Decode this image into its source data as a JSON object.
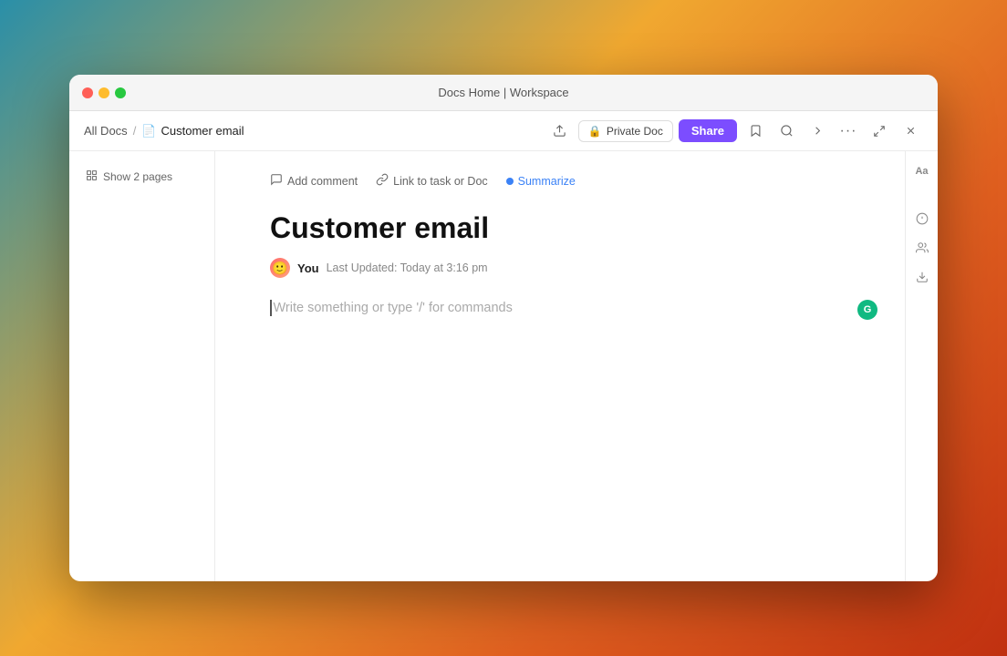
{
  "window": {
    "title": "Docs Home | Workspace"
  },
  "titlebar": {
    "title": "Docs Home | Workspace"
  },
  "breadcrumb": {
    "all_docs_label": "All Docs",
    "separator": "/",
    "current_doc_label": "Customer email"
  },
  "toolbar": {
    "private_doc_label": "Private Doc",
    "share_label": "Share"
  },
  "sidebar": {
    "show_pages_label": "Show 2 pages"
  },
  "doc_toolbar": {
    "add_comment_label": "Add comment",
    "link_task_label": "Link to task or Doc",
    "summarize_label": "Summarize"
  },
  "document": {
    "title": "Customer email",
    "author": "You",
    "last_updated": "Last Updated: Today at 3:16 pm",
    "placeholder": "Write something or type '/' for commands"
  },
  "icons": {
    "close": "●",
    "minimize": "●",
    "maximize": "●",
    "doc": "📄",
    "comment": "○",
    "link": "🔗",
    "bookmark": "☆",
    "search": "⌕",
    "export": "↗",
    "more": "···",
    "fullscreen": "⤢",
    "close_window": "✕",
    "lock": "🔒",
    "pages": "☰",
    "text_format": "Aa",
    "chevron": "›",
    "share_people": "👤",
    "download": "⬇"
  },
  "colors": {
    "share_btn": "#7c4dff",
    "ai_dot": "#10b981",
    "summarize_dot": "#3b82f6"
  }
}
